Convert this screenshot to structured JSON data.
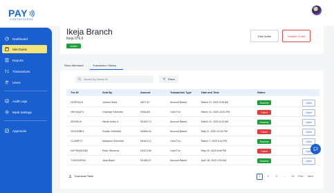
{
  "brand": {
    "name": "PAY",
    "tagline": "CONTACTLESS"
  },
  "sidebar": {
    "items": [
      {
        "label": "Dashboard",
        "icon": "dashboard-icon"
      },
      {
        "label": "Merchants",
        "icon": "merchants-icon",
        "active": true
      },
      {
        "label": "Reports",
        "icon": "reports-icon"
      },
      {
        "label": "Transactions",
        "icon": "transactions-icon"
      },
      {
        "label": "Users",
        "icon": "users-icon"
      },
      {
        "label": "Audit Logs",
        "icon": "audit-icon"
      },
      {
        "label": "Bank Settings",
        "icon": "bank-icon"
      },
      {
        "label": "Approvals",
        "icon": "approvals-icon"
      }
    ]
  },
  "branch": {
    "title": "Ikeja Branch",
    "id": "Ikeja 076.6",
    "status": "Active",
    "edit_label": "Edit Outlet",
    "disable_label": "Disable Outlet"
  },
  "tabs": [
    {
      "label": "Store Attendant"
    },
    {
      "label": "Transaction History",
      "active": true
    }
  ],
  "search": {
    "placeholder": "Search By Device ID"
  },
  "filters_label": "Filters",
  "table": {
    "headers": [
      "Txn ID",
      "Sold By",
      "Amount",
      "Transaction Type",
      "Date and Time",
      "Status"
    ],
    "rows": [
      {
        "id": "HLPESQJ1",
        "sold_by": "Jonann Ward",
        "amount": "N577.67",
        "type": "Account Based",
        "datetime": "March 21, 2020 9:09 AM",
        "status": "Success",
        "action": "Open"
      },
      {
        "id": "HNYUQAT1",
        "sold_by": "Charleys Schmeler",
        "amount": "N346.89",
        "type": "Card Txn",
        "datetime": "March 12, 2020 10:51 PM",
        "status": "Failed",
        "action": "Open"
      },
      {
        "id": "ZEVNKJ4",
        "sold_by": "Nicole Kuhic II",
        "amount": "N1463.73",
        "type": "Account Based",
        "datetime": "March 22, 2020 6:24 AM",
        "status": "Success",
        "action": "Open"
      },
      {
        "id": "GGJGDBE1",
        "sold_by": "Gussie Greenfelt",
        "amount": "N2846.40",
        "type": "Account Based",
        "datetime": "May 11, 2020 10:04 PM",
        "status": "Failed",
        "action": "Open"
      },
      {
        "id": "CLJAPF2T",
        "sold_by": "Adolphus Schmeler",
        "amount": "N1613.12",
        "type": "Card Txn",
        "datetime": "March 7, 2020 9:42 PM",
        "status": "Success",
        "action": "Open"
      },
      {
        "id": "NCPSNOKGB2",
        "sold_by": "Peter Okuneva",
        "amount": "N1673.98",
        "type": "Card Txn",
        "datetime": "May 15, 2020 8:46 PM",
        "status": "Failed",
        "action": "Open"
      },
      {
        "id": "TXKHCMSN1",
        "sold_by": "Jana Bayer",
        "amount": "N1383.07",
        "type": "Account Based",
        "datetime": "April 18, 2020 2:04 AM",
        "status": "Success",
        "action": "Open"
      }
    ]
  },
  "download_label": "Download Table",
  "pagination": {
    "pages": [
      "1",
      "2",
      "3",
      "...",
      "15"
    ],
    "current": "1",
    "prev_label": "Prev",
    "next_label": "Next"
  },
  "colors": {
    "primary": "#1a5fd0",
    "active_nav": "#f7e57a",
    "success": "#1e9e3a",
    "failed": "#e23b3b"
  }
}
